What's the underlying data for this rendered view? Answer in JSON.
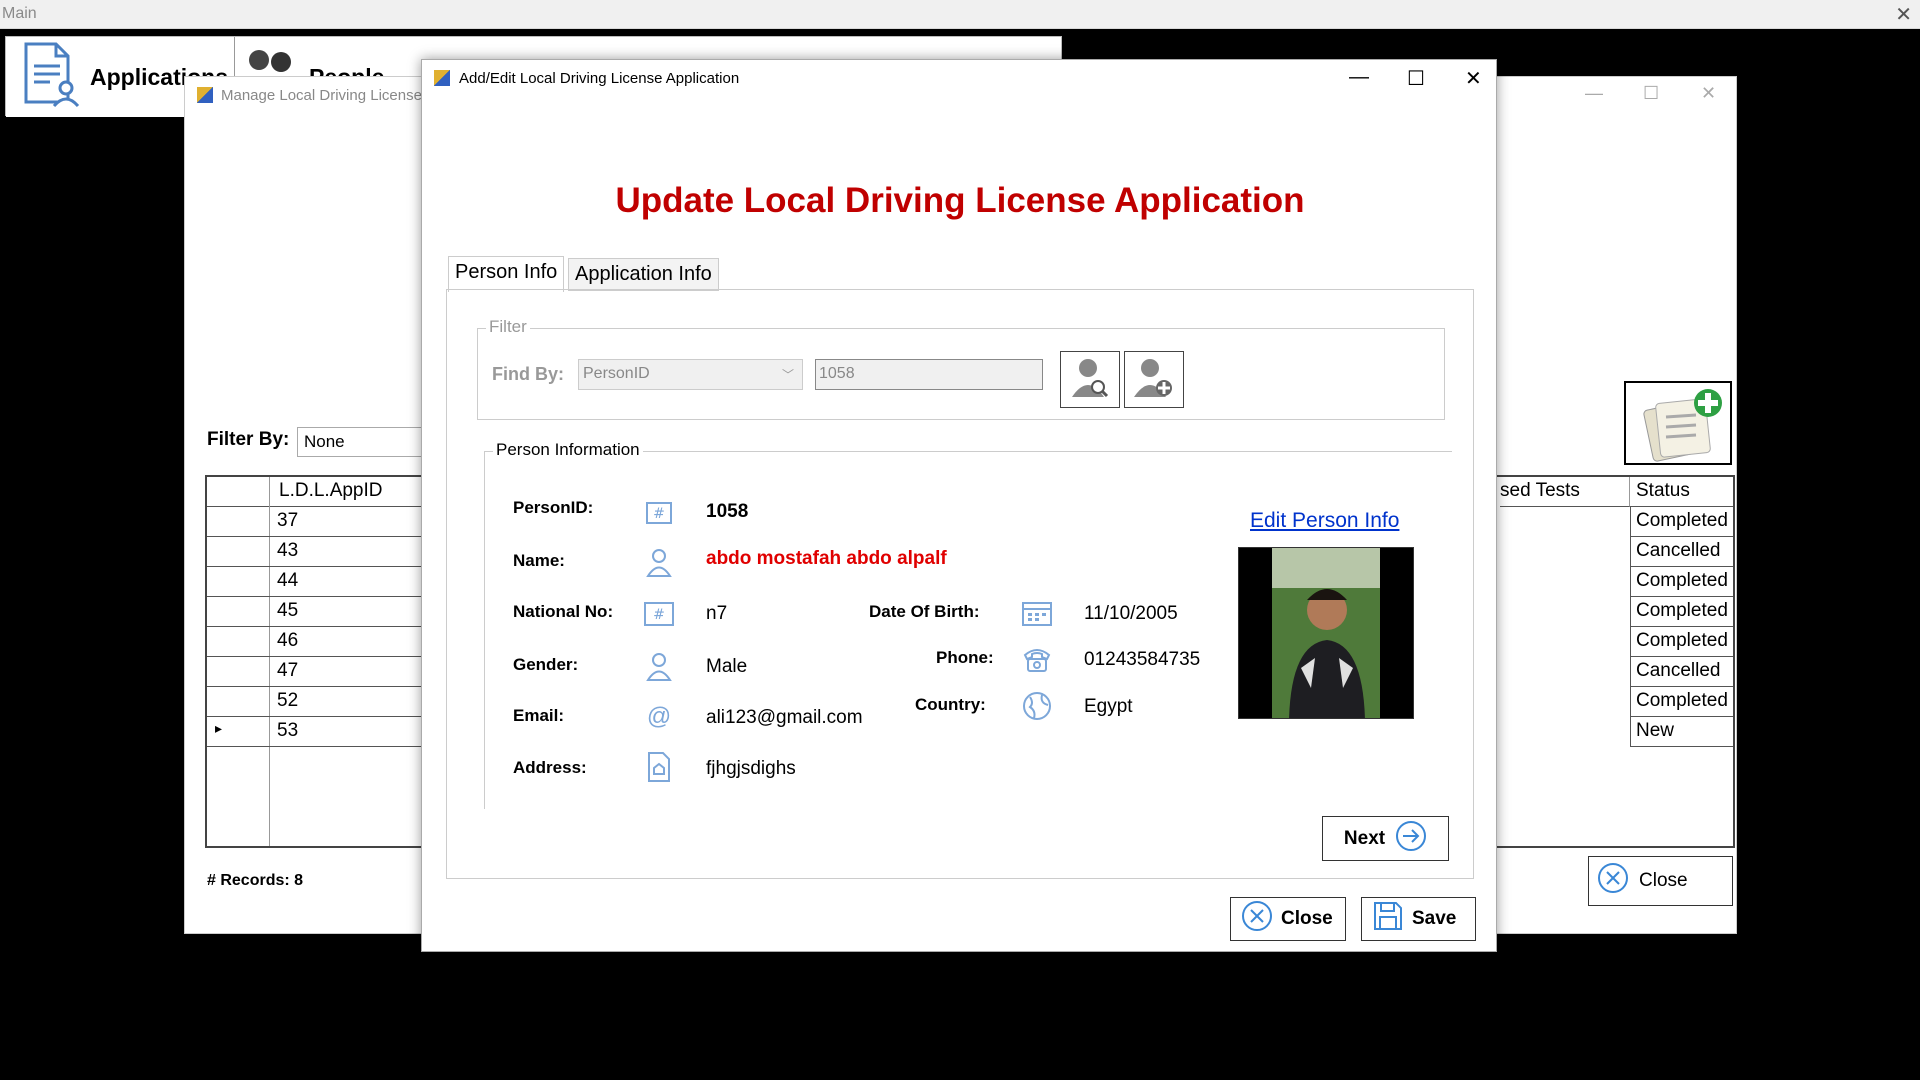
{
  "main": {
    "title": "Main",
    "close_glyph": "✕",
    "toolbar": [
      {
        "label": "Applications",
        "icon": "applications-icon"
      },
      {
        "label": "People",
        "icon": "people-icon"
      }
    ]
  },
  "manage": {
    "title": "Manage Local Driving Licenses",
    "filter_label": "Filter By:",
    "filter_value": "None",
    "columns": {
      "first": "L.D.L.AppID",
      "passed_tests": "sed Tests",
      "status": "Status"
    },
    "rows": [
      {
        "id": "37",
        "status": "Completed"
      },
      {
        "id": "43",
        "status": "Cancelled"
      },
      {
        "id": "44",
        "status": "Completed"
      },
      {
        "id": "45",
        "status": "Completed"
      },
      {
        "id": "46",
        "status": "Completed"
      },
      {
        "id": "47",
        "status": "Cancelled"
      },
      {
        "id": "52",
        "status": "Completed"
      },
      {
        "id": "53",
        "status": "New"
      }
    ],
    "selected_marker": "▸",
    "records_label": "# Records:",
    "records_count": "8",
    "close_label": "Close"
  },
  "dialog": {
    "title": "Add/Edit Local Driving License Application",
    "heading": "Update Local Driving License Application",
    "tabs": [
      {
        "label": "Person Info",
        "active": true
      },
      {
        "label": "Application Info",
        "active": false
      }
    ],
    "filter": {
      "legend": "Filter",
      "find_by_label": "Find By:",
      "find_by_value": "PersonID",
      "search_value": "1058"
    },
    "person": {
      "legend": "Person Information",
      "person_id_label": "PersonID:",
      "person_id": "1058",
      "name_label": "Name:",
      "name": "abdo mostafah abdo alpalf",
      "national_no_label": "National No:",
      "national_no": "n7",
      "gender_label": "Gender:",
      "gender": "Male",
      "email_label": "Email:",
      "email": "ali123@gmail.com",
      "address_label": "Address:",
      "address": "fjhgjsdighs",
      "dob_label": "Date Of Birth:",
      "dob": "11/10/2005",
      "phone_label": "Phone:",
      "phone": "01243584735",
      "country_label": "Country:",
      "country": "Egypt",
      "edit_link": "Edit Person Info"
    },
    "next_label": "Next",
    "close_label": "Close",
    "save_label": "Save"
  },
  "colors": {
    "heading_red": "#c00000",
    "name_red": "#e00000",
    "link_blue": "#0033cc",
    "icon_blue": "#7da7d9"
  }
}
